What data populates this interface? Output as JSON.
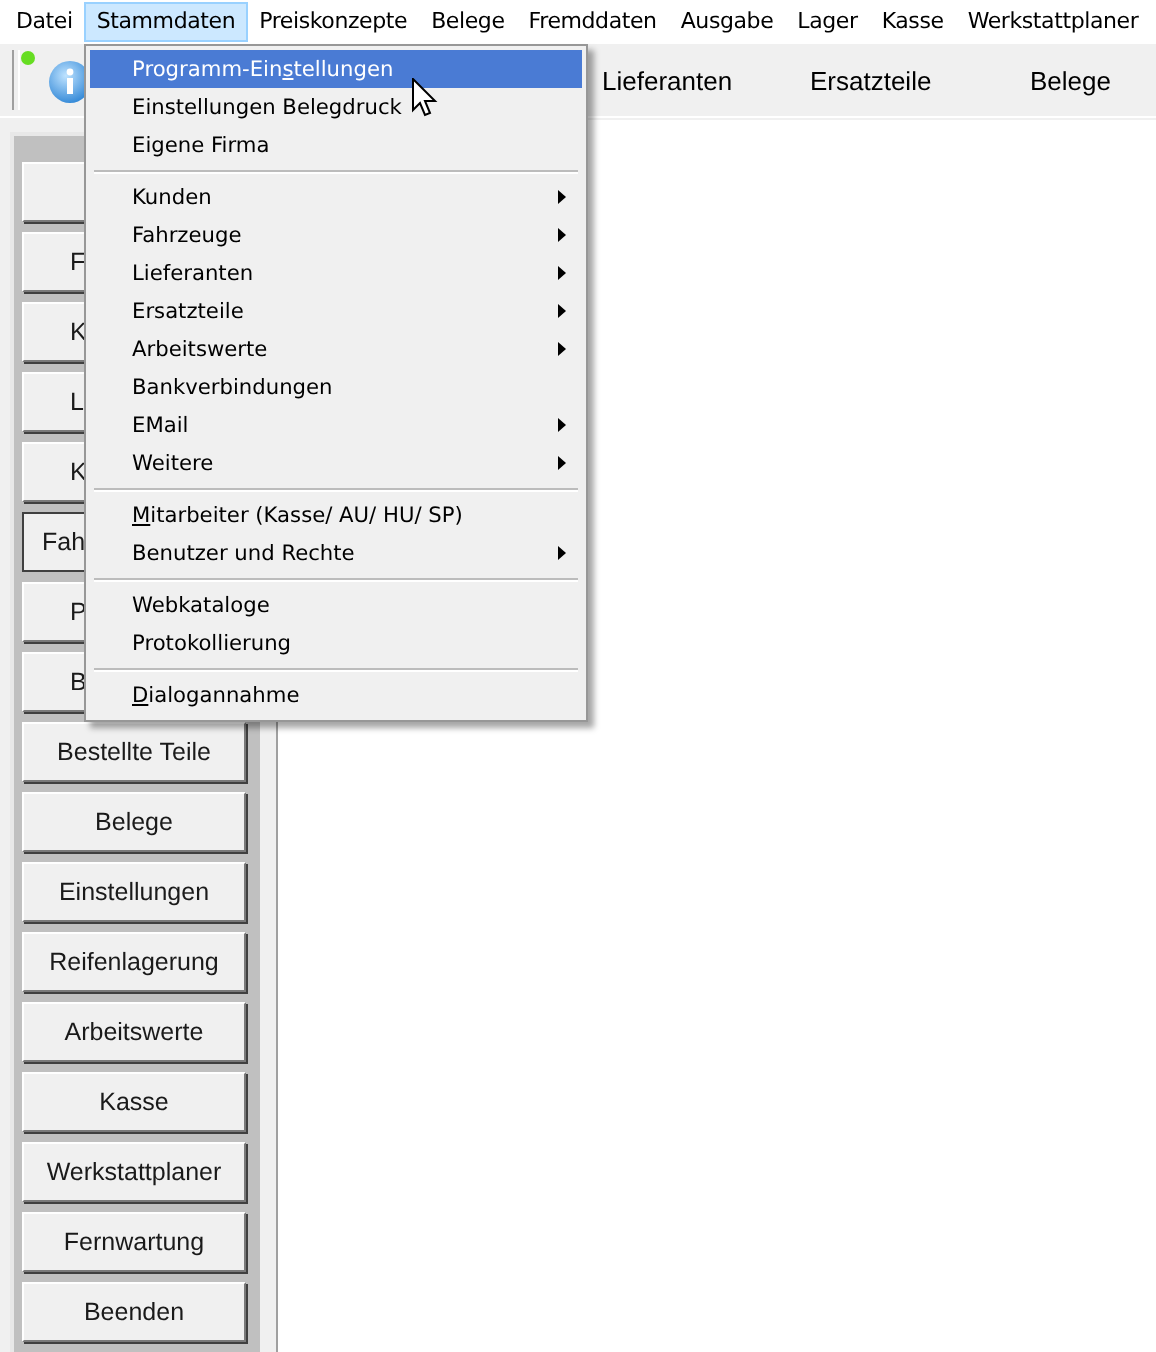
{
  "menubar": [
    {
      "label": "Datei",
      "selected": false
    },
    {
      "label": "Stammdaten",
      "selected": true
    },
    {
      "label": "Preiskonzepte",
      "selected": false
    },
    {
      "label": "Belege",
      "selected": false
    },
    {
      "label": "Fremddaten",
      "selected": false
    },
    {
      "label": "Ausgabe",
      "selected": false
    },
    {
      "label": "Lager",
      "selected": false
    },
    {
      "label": "Kasse",
      "selected": false
    },
    {
      "label": "Werkstattplaner",
      "selected": false
    }
  ],
  "toolbar": {
    "items": [
      "Lieferanten",
      "Ersatzteile",
      "Belege"
    ]
  },
  "sidebar": {
    "buttons": [
      {
        "kind": "covered",
        "selected": false
      },
      {
        "kind": "partial",
        "label": "F",
        "selected": false
      },
      {
        "kind": "partial",
        "label": "K",
        "selected": false
      },
      {
        "kind": "partial",
        "label": "L",
        "selected": false
      },
      {
        "kind": "partial",
        "label": "K",
        "selected": false
      },
      {
        "kind": "partial",
        "label": "Fah",
        "selected": true
      },
      {
        "kind": "partial",
        "label": "P",
        "selected": false
      },
      {
        "kind": "partial",
        "label": "B",
        "selected": false
      },
      {
        "kind": "full",
        "label": "Bestellte Teile",
        "selected": false
      },
      {
        "kind": "full",
        "label": "Belege",
        "selected": false
      },
      {
        "kind": "full",
        "label": "Einstellungen",
        "selected": false
      },
      {
        "kind": "full",
        "label": "Reifenlagerung",
        "selected": false
      },
      {
        "kind": "full",
        "label": "Arbeitswerte",
        "selected": false
      },
      {
        "kind": "full",
        "label": "Kasse",
        "selected": false
      },
      {
        "kind": "full",
        "label": "Werkstattplaner",
        "selected": false
      },
      {
        "kind": "full",
        "label": "Fernwartung",
        "selected": false
      },
      {
        "kind": "full",
        "label": "Beenden",
        "selected": false
      }
    ]
  },
  "dropdown_menu": {
    "groups": [
      [
        {
          "pre": "Programm-Ein",
          "key": "s",
          "post": "tellungen",
          "selected": true,
          "submenu": false
        },
        {
          "pre": "Einstellungen Belegdruck",
          "selected": false,
          "submenu": false
        },
        {
          "pre": "Eigene Firma",
          "selected": false,
          "submenu": false
        }
      ],
      [
        {
          "pre": "Kunden",
          "selected": false,
          "submenu": true
        },
        {
          "pre": "Fahrzeuge",
          "selected": false,
          "submenu": true
        },
        {
          "pre": "Lieferanten",
          "selected": false,
          "submenu": true
        },
        {
          "pre": "Ersatzteile",
          "selected": false,
          "submenu": true
        },
        {
          "pre": "Arbeitswerte",
          "selected": false,
          "submenu": true
        },
        {
          "pre": "Bankverbindungen",
          "selected": false,
          "submenu": false
        },
        {
          "pre": "EMail",
          "selected": false,
          "submenu": true
        },
        {
          "pre": "Weitere",
          "selected": false,
          "submenu": true
        }
      ],
      [
        {
          "key": "M",
          "post": "itarbeiter (Kasse/ AU/ HU/ SP)",
          "selected": false,
          "submenu": false
        },
        {
          "pre": "Benutzer und Rechte",
          "selected": false,
          "submenu": true
        }
      ],
      [
        {
          "pre": "Webkataloge",
          "selected": false,
          "submenu": false
        },
        {
          "pre": "Protokollierung",
          "selected": false,
          "submenu": false
        }
      ],
      [
        {
          "key": "D",
          "post": "ialogannahme",
          "selected": false,
          "submenu": false
        }
      ]
    ]
  }
}
